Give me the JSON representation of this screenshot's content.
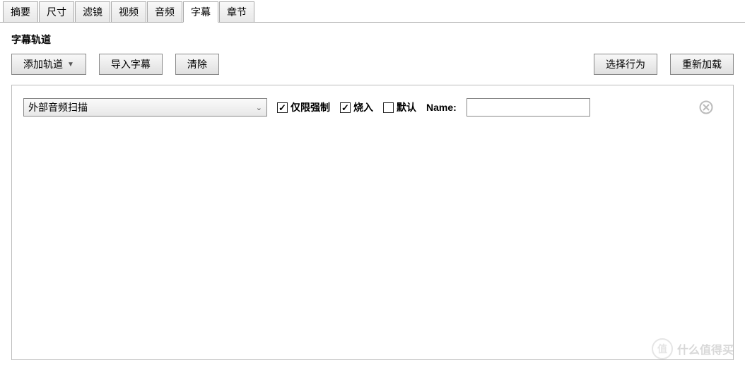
{
  "tabs": {
    "items": [
      "摘要",
      "尺寸",
      "滤镜",
      "视频",
      "音频",
      "字幕",
      "章节"
    ],
    "active_index": 5
  },
  "section": {
    "title": "字幕轨道"
  },
  "toolbar": {
    "add_track": "添加轨道",
    "import": "导入字幕",
    "clear": "清除",
    "select_behavior": "选择行为",
    "reload": "重新加载"
  },
  "track": {
    "source": "外部音频扫描",
    "forced_label": "仅限强制",
    "forced_checked": true,
    "burn_label": "烧入",
    "burn_checked": true,
    "default_label": "默认",
    "default_checked": false,
    "name_label": "Name:",
    "name_value": ""
  },
  "watermark": {
    "circle": "值",
    "text": "什么值得买"
  }
}
